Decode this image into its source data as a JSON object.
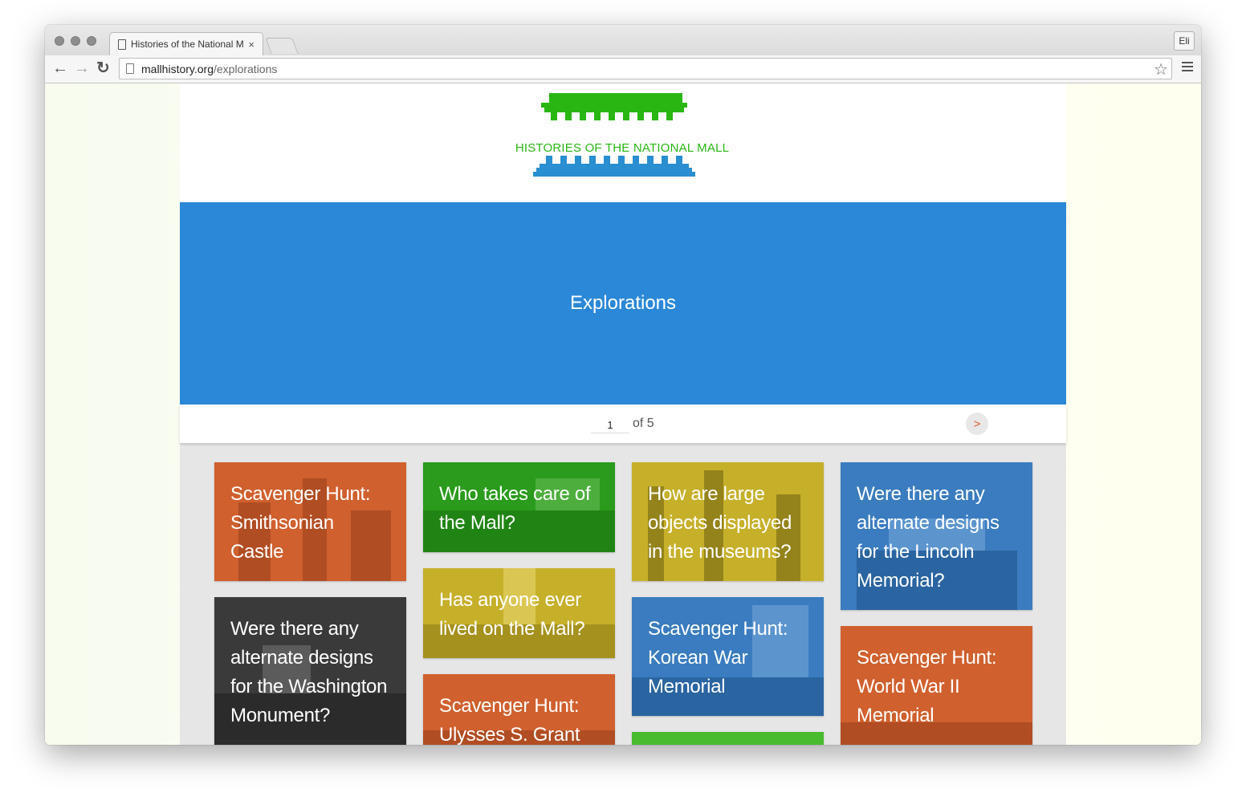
{
  "browser": {
    "tab_title": "Histories of the National M",
    "tab_close": "×",
    "profile": "Eli",
    "url_host": "mallhistory.org",
    "url_path": "/explorations",
    "back": "←",
    "forward": "→",
    "reload": "↻",
    "star": "☆"
  },
  "site": {
    "logo_text": "HISTORIES OF THE NATIONAL MALL",
    "hero_title": "Explorations",
    "colors": {
      "green": "#29b613",
      "blue": "#2b88d8",
      "orange": "#d0602e"
    }
  },
  "pager": {
    "current_page": "1",
    "of_text": "of 5",
    "next": ">"
  },
  "cards": [
    {
      "title": "Scavenger Hunt: Smithsonian Castle",
      "color": "orange"
    },
    {
      "title": "Were there any alternate designs for the Washington Monument?",
      "color": "gray"
    },
    {
      "title": "Who takes care of the Mall?",
      "color": "green"
    },
    {
      "title": "Has anyone ever lived on the Mall?",
      "color": "yellow"
    },
    {
      "title": "Scavenger Hunt: Ulysses S. Grant",
      "color": "orange"
    },
    {
      "title": "How are large objects displayed in the museums?",
      "color": "yellow"
    },
    {
      "title": "Scavenger Hunt: Korean War Memorial",
      "color": "blue"
    },
    {
      "title": "",
      "color": "bright-green"
    },
    {
      "title": "Were there any alternate designs for the Lincoln Memorial?",
      "color": "blue"
    },
    {
      "title": "Scavenger Hunt: World War II Memorial",
      "color": "orange"
    }
  ]
}
